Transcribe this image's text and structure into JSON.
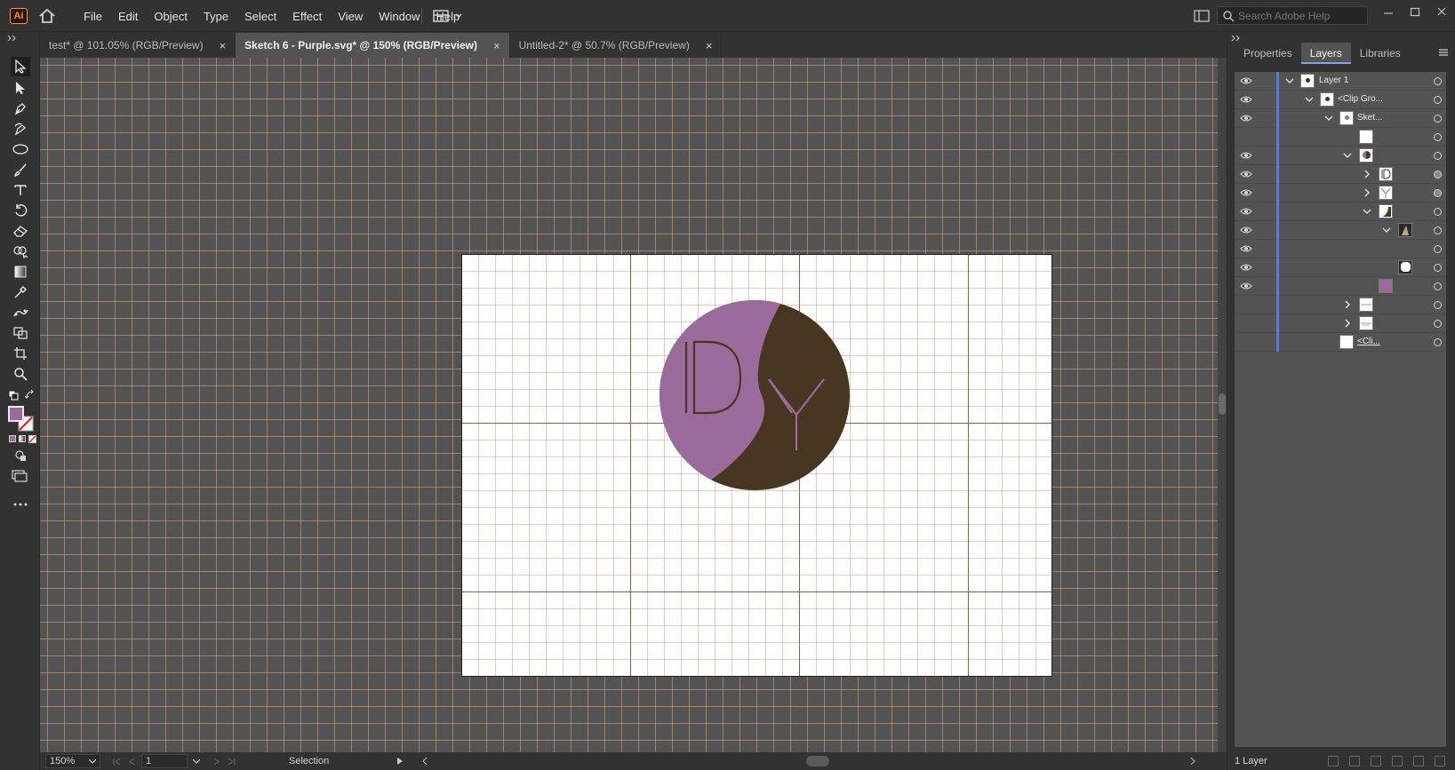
{
  "app": {
    "logo_text": "Ai"
  },
  "menu": [
    "File",
    "Edit",
    "Object",
    "Type",
    "Select",
    "Effect",
    "View",
    "Window",
    "Help"
  ],
  "search": {
    "placeholder": "Search Adobe Help"
  },
  "tabs": [
    {
      "label": "test* @ 101.05% (RGB/Preview)",
      "close": "×",
      "active": false
    },
    {
      "label": "Sketch 6 - Purple.svg* @ 150% (RGB/Preview)",
      "close": "×",
      "active": true
    },
    {
      "label": "Untitled-2* @ 50.7% (RGB/Preview)",
      "close": "×",
      "active": false
    }
  ],
  "tools": [
    "selection-tool",
    "direct-selection-tool",
    "pen-tool",
    "curvature-tool",
    "ellipse-tool",
    "paintbrush-tool",
    "type-tool",
    "rotate-tool",
    "eraser-tool",
    "shape-builder-tool",
    "gradient-tool",
    "eyedropper-tool",
    "puppet-warp-tool",
    "free-transform-tool",
    "artboard-tool",
    "zoom-tool"
  ],
  "colors": {
    "fill": "#9b6b9b",
    "logo_purple": "#9b6b9b",
    "logo_brown": "#473720",
    "layer_color": "#4f7fe0"
  },
  "status": {
    "zoom": "150%",
    "artboard_number": "1",
    "mode": "Selection"
  },
  "panel": {
    "tabs": [
      "Properties",
      "Layers",
      "Libraries"
    ],
    "active_tab": "Layers",
    "layers": [
      {
        "name": "Layer 1"
      },
      {
        "name": "<Clip Gro..."
      },
      {
        "name": "Sket..."
      },
      {
        "name": "<Cli..."
      }
    ],
    "footer": "1 Layer"
  }
}
